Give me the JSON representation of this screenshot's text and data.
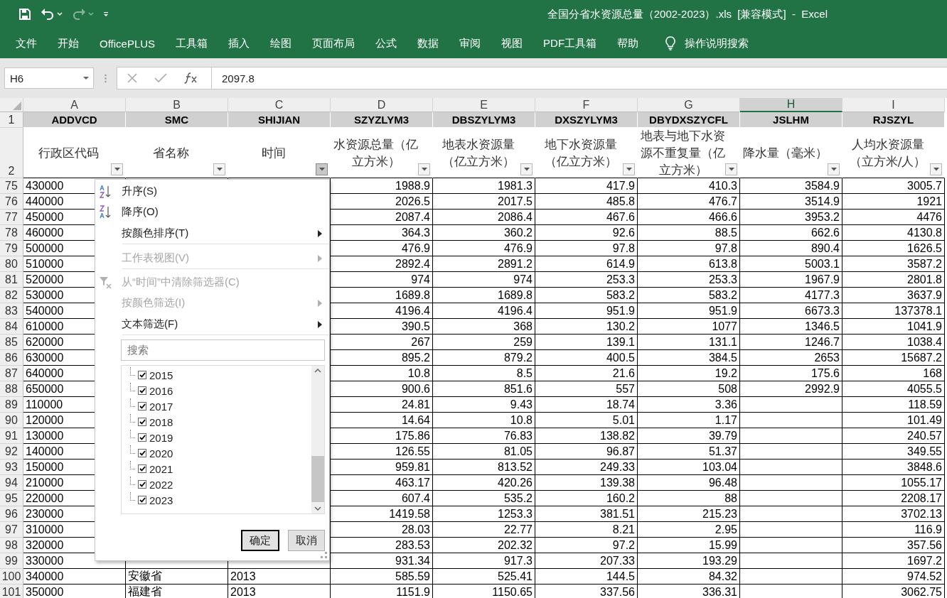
{
  "title_bar": {
    "title": "全国分省水资源总量（2002-2023）.xls  [兼容模式]  -  Excel"
  },
  "ribbon_tabs": [
    "文件",
    "开始",
    "OfficePLUS",
    "工具箱",
    "插入",
    "绘图",
    "页面布局",
    "公式",
    "数据",
    "审阅",
    "视图",
    "PDF工具箱",
    "帮助"
  ],
  "tell_me": "操作说明搜索",
  "name_box": "H6",
  "formula": "2097.8",
  "header_rows": [
    "1",
    "2"
  ],
  "columns": [
    {
      "letter": "A",
      "field": "ADDVCD",
      "label": "行政区代码",
      "kind": "text",
      "selected": false,
      "filter_active": false
    },
    {
      "letter": "B",
      "field": "SMC",
      "label": "省名称",
      "kind": "text",
      "selected": false,
      "filter_active": false
    },
    {
      "letter": "C",
      "field": "SHIJIAN",
      "label": "时间",
      "kind": "text",
      "selected": false,
      "filter_active": true
    },
    {
      "letter": "D",
      "field": "SZYZLYM3",
      "label": "水资源总量（亿立方米）",
      "kind": "number",
      "selected": false,
      "filter_active": false
    },
    {
      "letter": "E",
      "field": "DBSZYLYM3",
      "label": "地表水资源量（亿立方米）",
      "kind": "number",
      "selected": false,
      "filter_active": false
    },
    {
      "letter": "F",
      "field": "DXSZYLYM3",
      "label": "地下水资源量（亿立方米）",
      "kind": "number",
      "selected": false,
      "filter_active": false
    },
    {
      "letter": "G",
      "field": "DBYDXSZYCFL",
      "label": "地表与地下水资源不重复量（亿立方米）",
      "kind": "number",
      "selected": false,
      "filter_active": false
    },
    {
      "letter": "H",
      "field": "JSLHM",
      "label": "降水量（毫米）",
      "kind": "number",
      "selected": true,
      "filter_active": false
    },
    {
      "letter": "I",
      "field": "RJSZYL",
      "label": "人均水资源量（立方米/人）",
      "kind": "number",
      "selected": false,
      "filter_active": false
    }
  ],
  "rows": [
    {
      "num": "75",
      "cells": {
        "A": "430000",
        "D": "1988.9",
        "E": "1981.3",
        "F": "417.9",
        "G": "410.3",
        "H": "3584.9",
        "I": "3005.7"
      }
    },
    {
      "num": "76",
      "cells": {
        "A": "440000",
        "D": "2026.5",
        "E": "2017.5",
        "F": "485.8",
        "G": "476.7",
        "H": "3514.9",
        "I": "1921"
      }
    },
    {
      "num": "77",
      "cells": {
        "A": "450000",
        "D": "2087.4",
        "E": "2086.4",
        "F": "467.6",
        "G": "466.6",
        "H": "3953.2",
        "I": "4476"
      }
    },
    {
      "num": "78",
      "cells": {
        "A": "460000",
        "D": "364.3",
        "E": "360.2",
        "F": "92.6",
        "G": "88.5",
        "H": "662.6",
        "I": "4130.8"
      }
    },
    {
      "num": "79",
      "cells": {
        "A": "500000",
        "D": "476.9",
        "E": "476.9",
        "F": "97.8",
        "G": "97.8",
        "H": "890.4",
        "I": "1626.5"
      }
    },
    {
      "num": "80",
      "cells": {
        "A": "510000",
        "D": "2892.4",
        "E": "2891.2",
        "F": "614.9",
        "G": "613.8",
        "H": "5003.1",
        "I": "3587.2"
      }
    },
    {
      "num": "81",
      "cells": {
        "A": "520000",
        "D": "974",
        "E": "974",
        "F": "253.3",
        "G": "253.3",
        "H": "1967.9",
        "I": "2801.8"
      }
    },
    {
      "num": "82",
      "cells": {
        "A": "530000",
        "D": "1689.8",
        "E": "1689.8",
        "F": "583.2",
        "G": "583.2",
        "H": "4177.3",
        "I": "3637.9"
      }
    },
    {
      "num": "83",
      "cells": {
        "A": "540000",
        "D": "4196.4",
        "E": "4196.4",
        "F": "951.9",
        "G": "951.9",
        "H": "6673.3",
        "I": "137378.1"
      }
    },
    {
      "num": "84",
      "cells": {
        "A": "610000",
        "D": "390.5",
        "E": "368",
        "F": "130.2",
        "G": "1077",
        "H": "1346.5",
        "I": "1041.9"
      }
    },
    {
      "num": "85",
      "cells": {
        "A": "620000",
        "D": "267",
        "E": "259",
        "F": "139.1",
        "G": "131.1",
        "H": "1246.7",
        "I": "1038.4"
      }
    },
    {
      "num": "86",
      "cells": {
        "A": "630000",
        "D": "895.2",
        "E": "879.2",
        "F": "400.5",
        "G": "384.5",
        "H": "2653",
        "I": "15687.2"
      }
    },
    {
      "num": "87",
      "cells": {
        "A": "640000",
        "D": "10.8",
        "E": "8.5",
        "F": "21.6",
        "G": "19.2",
        "H": "175.6",
        "I": "168"
      }
    },
    {
      "num": "88",
      "cells": {
        "A": "650000",
        "D": "900.6",
        "E": "851.6",
        "F": "557",
        "G": "508",
        "H": "2992.9",
        "I": "4055.5"
      }
    },
    {
      "num": "89",
      "cells": {
        "A": "110000",
        "D": "24.81",
        "E": "9.43",
        "F": "18.74",
        "G": "3.36",
        "I": "118.59"
      }
    },
    {
      "num": "90",
      "cells": {
        "A": "120000",
        "D": "14.64",
        "E": "10.8",
        "F": "5.01",
        "G": "1.17",
        "I": "101.49"
      }
    },
    {
      "num": "91",
      "cells": {
        "A": "130000",
        "D": "175.86",
        "E": "76.83",
        "F": "138.82",
        "G": "39.79",
        "I": "240.57"
      }
    },
    {
      "num": "92",
      "cells": {
        "A": "140000",
        "D": "126.55",
        "E": "81.05",
        "F": "96.87",
        "G": "51.37",
        "I": "349.55"
      }
    },
    {
      "num": "93",
      "cells": {
        "A": "150000",
        "D": "959.81",
        "E": "813.52",
        "F": "249.33",
        "G": "103.04",
        "I": "3848.6"
      }
    },
    {
      "num": "94",
      "cells": {
        "A": "210000",
        "D": "463.17",
        "E": "420.26",
        "F": "139.38",
        "G": "96.48",
        "I": "1055.17"
      }
    },
    {
      "num": "95",
      "cells": {
        "A": "220000",
        "D": "607.4",
        "E": "535.2",
        "F": "160.2",
        "G": "88",
        "I": "2208.17"
      }
    },
    {
      "num": "96",
      "cells": {
        "A": "230000",
        "D": "1419.58",
        "E": "1253.3",
        "F": "381.51",
        "G": "215.23",
        "I": "3702.13"
      }
    },
    {
      "num": "97",
      "cells": {
        "A": "310000",
        "D": "28.03",
        "E": "22.77",
        "F": "8.21",
        "G": "2.95",
        "I": "116.9"
      }
    },
    {
      "num": "98",
      "cells": {
        "A": "320000",
        "D": "283.53",
        "E": "202.32",
        "F": "97.2",
        "G": "15.99",
        "I": "357.56"
      }
    },
    {
      "num": "99",
      "cells": {
        "A": "330000",
        "D": "931.34",
        "E": "917.3",
        "F": "207.33",
        "G": "193.29",
        "I": "1697.2"
      }
    },
    {
      "num": "100",
      "cells": {
        "A": "340000",
        "B": "安徽省",
        "C": "2013",
        "D": "585.59",
        "E": "525.41",
        "F": "144.5",
        "G": "84.32",
        "I": "974.52"
      }
    },
    {
      "num": "101",
      "cells": {
        "A": "350000",
        "B": "福建省",
        "C": "2013",
        "D": "1151.9",
        "E": "1150.65",
        "F": "337.56",
        "G": "336.31",
        "I": "3062.75"
      }
    }
  ],
  "filter_menu": {
    "items": [
      {
        "label": "升序(S)",
        "kind": "sort-asc",
        "disabled": false,
        "submenu": false,
        "separator_after": false
      },
      {
        "label": "降序(O)",
        "kind": "sort-desc",
        "disabled": false,
        "submenu": false,
        "separator_after": false
      },
      {
        "label": "按颜色排序(T)",
        "kind": "plain",
        "disabled": false,
        "submenu": true,
        "separator_after": true
      },
      {
        "label": "工作表视图(V)",
        "kind": "plain",
        "disabled": true,
        "submenu": true,
        "separator_after": true
      },
      {
        "label": "从“时间”中清除筛选器(C)",
        "kind": "clear-filter",
        "disabled": true,
        "submenu": false,
        "separator_after": false
      },
      {
        "label": "按颜色筛选(I)",
        "kind": "plain",
        "disabled": true,
        "submenu": true,
        "separator_after": false
      },
      {
        "label": "文本筛选(F)",
        "kind": "plain",
        "disabled": false,
        "submenu": true,
        "separator_after": true
      }
    ],
    "search_placeholder": "搜索",
    "values": [
      {
        "label": "2015",
        "checked": true
      },
      {
        "label": "2016",
        "checked": true
      },
      {
        "label": "2017",
        "checked": true
      },
      {
        "label": "2018",
        "checked": true
      },
      {
        "label": "2019",
        "checked": true
      },
      {
        "label": "2020",
        "checked": true
      },
      {
        "label": "2021",
        "checked": true
      },
      {
        "label": "2022",
        "checked": true
      },
      {
        "label": "2023",
        "checked": true
      }
    ],
    "buttons": [
      {
        "label": "确定",
        "default": true
      },
      {
        "label": "取消",
        "default": false
      }
    ]
  }
}
